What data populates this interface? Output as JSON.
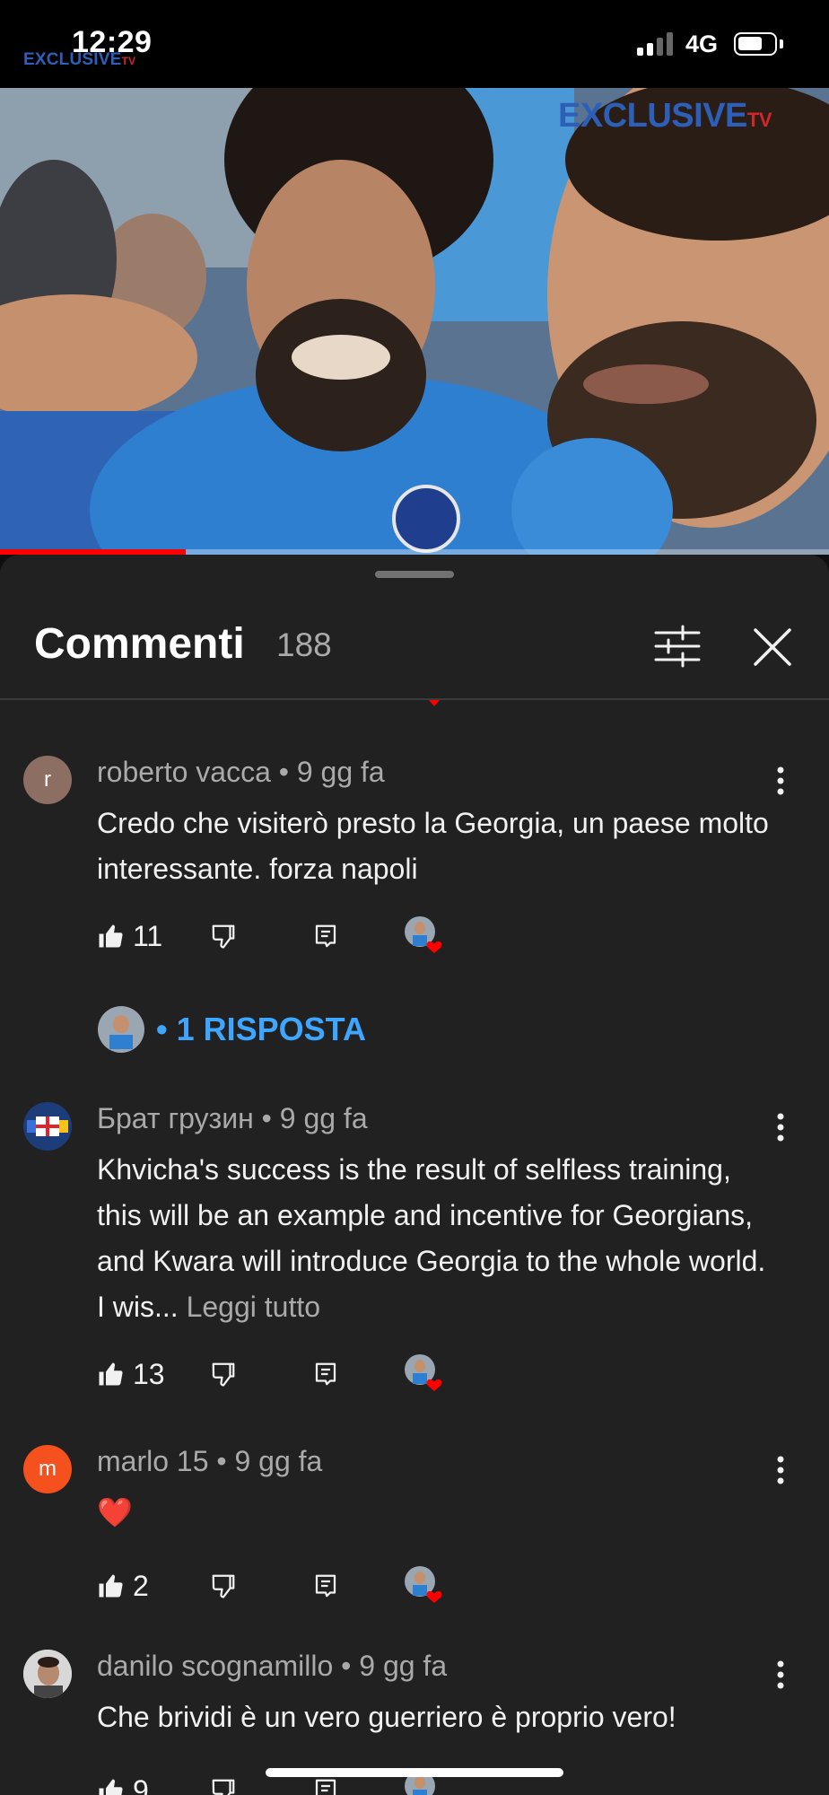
{
  "status_bar": {
    "time": "12:29",
    "network": "4G",
    "watermark_main": "EXCLUSIVE",
    "watermark_tv": "TV"
  },
  "video": {
    "watermark_main": "EXCLUSIVE",
    "watermark_tv": "TV",
    "progress_fraction": 0.224
  },
  "comments_panel": {
    "title": "Commenti",
    "count": "188",
    "comments": [
      {
        "avatar_letter": "r",
        "avatar_color": "#8d6e63",
        "author": "roberto vacca",
        "time": "9 gg fa",
        "text": "Credo che visiterò presto la Georgia, un paese molto interessante. forza napoli",
        "likes": "11",
        "replies_label": "• 1 RISPOSTA"
      },
      {
        "avatar_letter": "",
        "avatar_color": "#1c3d7a",
        "author": "Брат грузин",
        "time": "9 gg fa",
        "text": "Khvicha's success is the result of selfless training, this will be an example and incentive for Georgians, and Kwara will introduce Georgia to the whole world. I wis...",
        "read_more": "Leggi tutto",
        "likes": "13"
      },
      {
        "avatar_letter": "m",
        "avatar_color": "#f4511e",
        "author": "marlo 15",
        "time": "9 gg fa",
        "text": "❤️",
        "likes": "2"
      },
      {
        "avatar_letter": "",
        "avatar_color": "#cfcfcf",
        "author": "danilo scognamillo",
        "time": "9 gg fa",
        "text": "Che brividi è un vero guerriero è proprio vero!",
        "likes": "9"
      }
    ]
  },
  "colors": {
    "accent_red": "#ff0000",
    "link_blue": "#3ea6ff",
    "sheet_bg": "#212121"
  },
  "icons": [
    "filter-icon",
    "close-icon",
    "like-icon",
    "dislike-icon",
    "reply-icon",
    "more-vert-icon",
    "creator-heart-icon"
  ]
}
